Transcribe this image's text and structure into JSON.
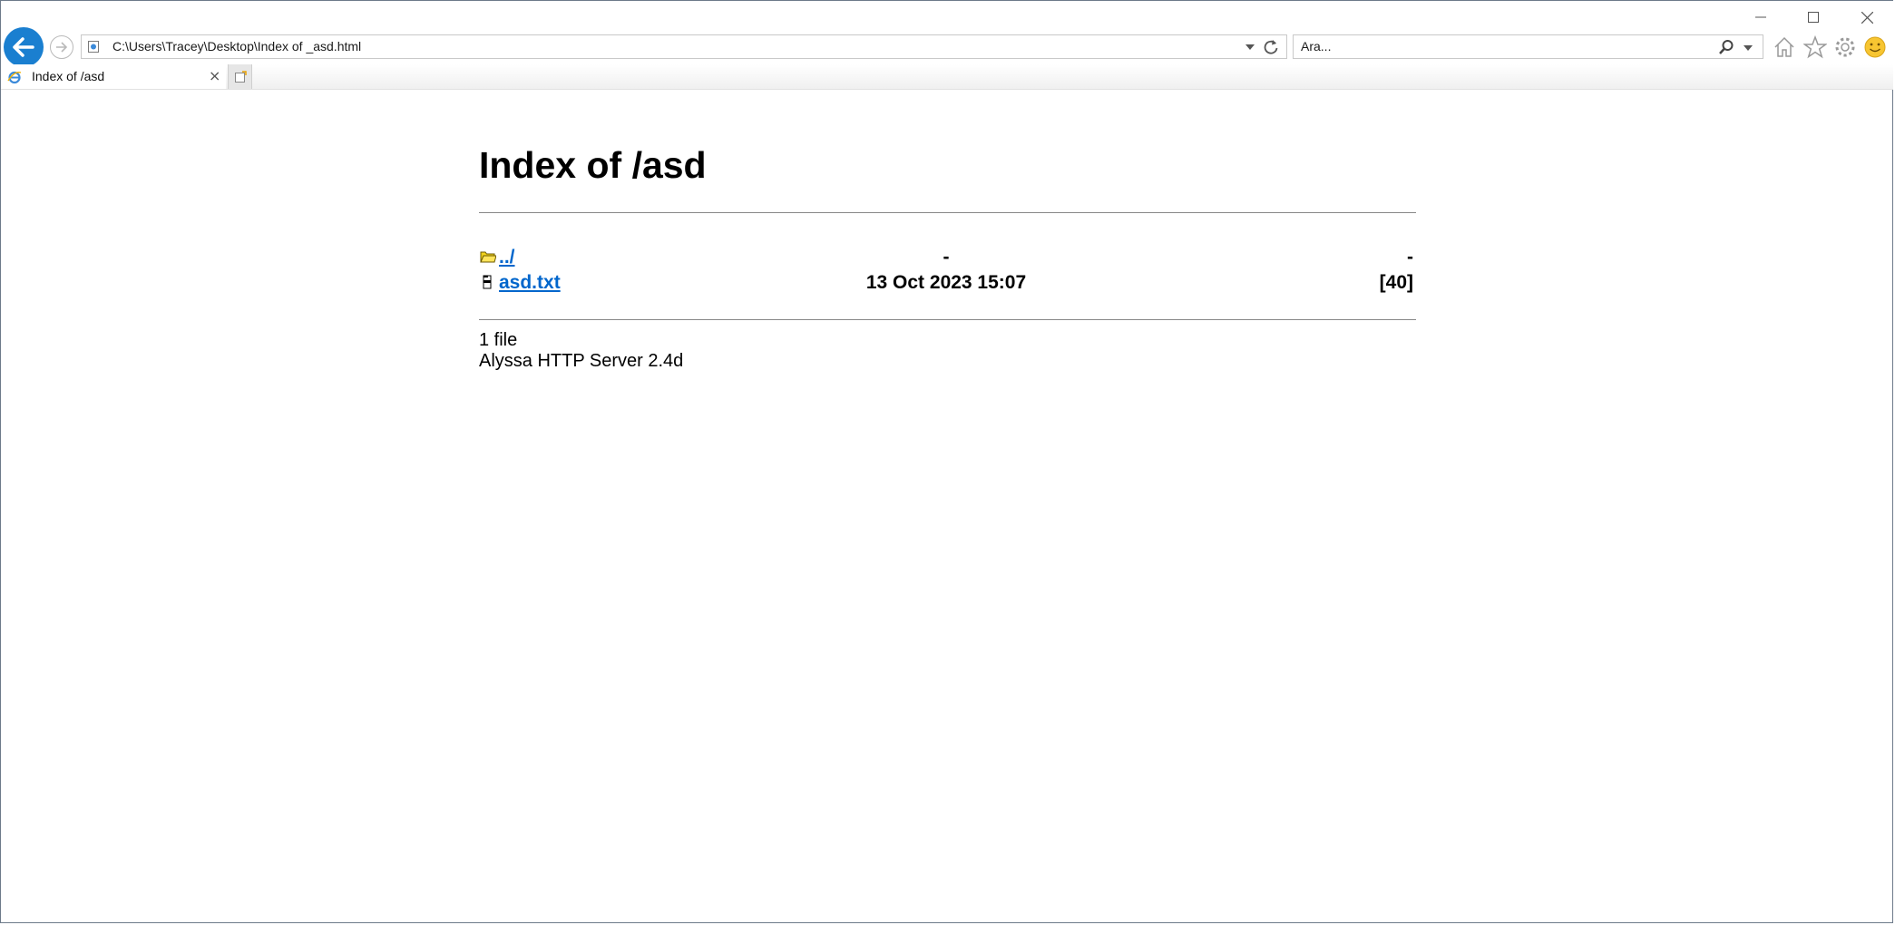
{
  "browser": {
    "address": "C:\\Users\\Tracey\\Desktop\\Index of _asd.html",
    "search_placeholder": "Ara...",
    "tab_title": "Index of /asd",
    "accent_color": "#1a7fd0"
  },
  "page": {
    "title": "Index of /asd",
    "entries": [
      {
        "name": "../",
        "date": "-",
        "size": "-",
        "icon": "folder-icon"
      },
      {
        "name": "asd.txt",
        "date": "13 Oct 2023 15:07",
        "size": "[40]",
        "icon": "file-icon"
      }
    ],
    "file_count": "1 file",
    "server": "Alyssa HTTP Server 2.4d",
    "link_color": "#0066cc"
  }
}
